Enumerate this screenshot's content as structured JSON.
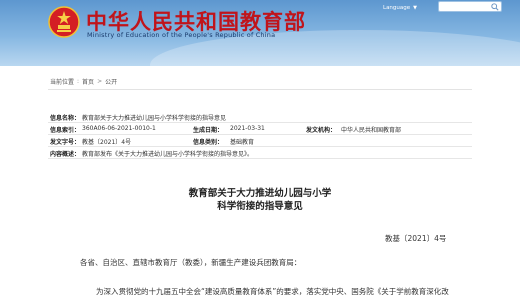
{
  "header": {
    "title": "中华人民共和国教育部",
    "subtitle": "Ministry of Education of the People's Republic of China",
    "language_label": "Language",
    "colors": {
      "title": "#c0141b",
      "banner": "#5d97cf"
    }
  },
  "breadcrumb": {
    "items": [
      "当前位置",
      "首页",
      "公开"
    ]
  },
  "info": {
    "index_label": "信息名称：",
    "index_value": "教育部关于大力推进幼儿园与小学科学衔接的指导意见",
    "code_label": "信息索引：",
    "code_value": "360A06-06-2021-0010-1",
    "date_label": "生成日期：",
    "date_value": "2021-03-31",
    "publisher_label": "发文机构：",
    "publisher_value": "中华人民共和国教育部",
    "docno_label": "发文字号：",
    "docno_value": "教基〔2021〕4号",
    "category_label": "信息类别：",
    "category_value": "基础教育",
    "summary_label": "内容概述：",
    "summary_value": "教育部发布《关于大力推进幼儿园与小学科学衔接的指导意见》。"
  },
  "document": {
    "title_line1": "教育部关于大力推进幼儿园与小学",
    "title_line2": "科学衔接的指导意见",
    "number": "教基〔2021〕4号",
    "salutation": "各省、自治区、直辖市教育厅（教委），新疆生产建设兵团教育局：",
    "body_line1": "为深入贯彻党的十九届五中全会“建设高质量教育体系”的要求，落实党中央、国务院《关于学前教育深化改"
  }
}
